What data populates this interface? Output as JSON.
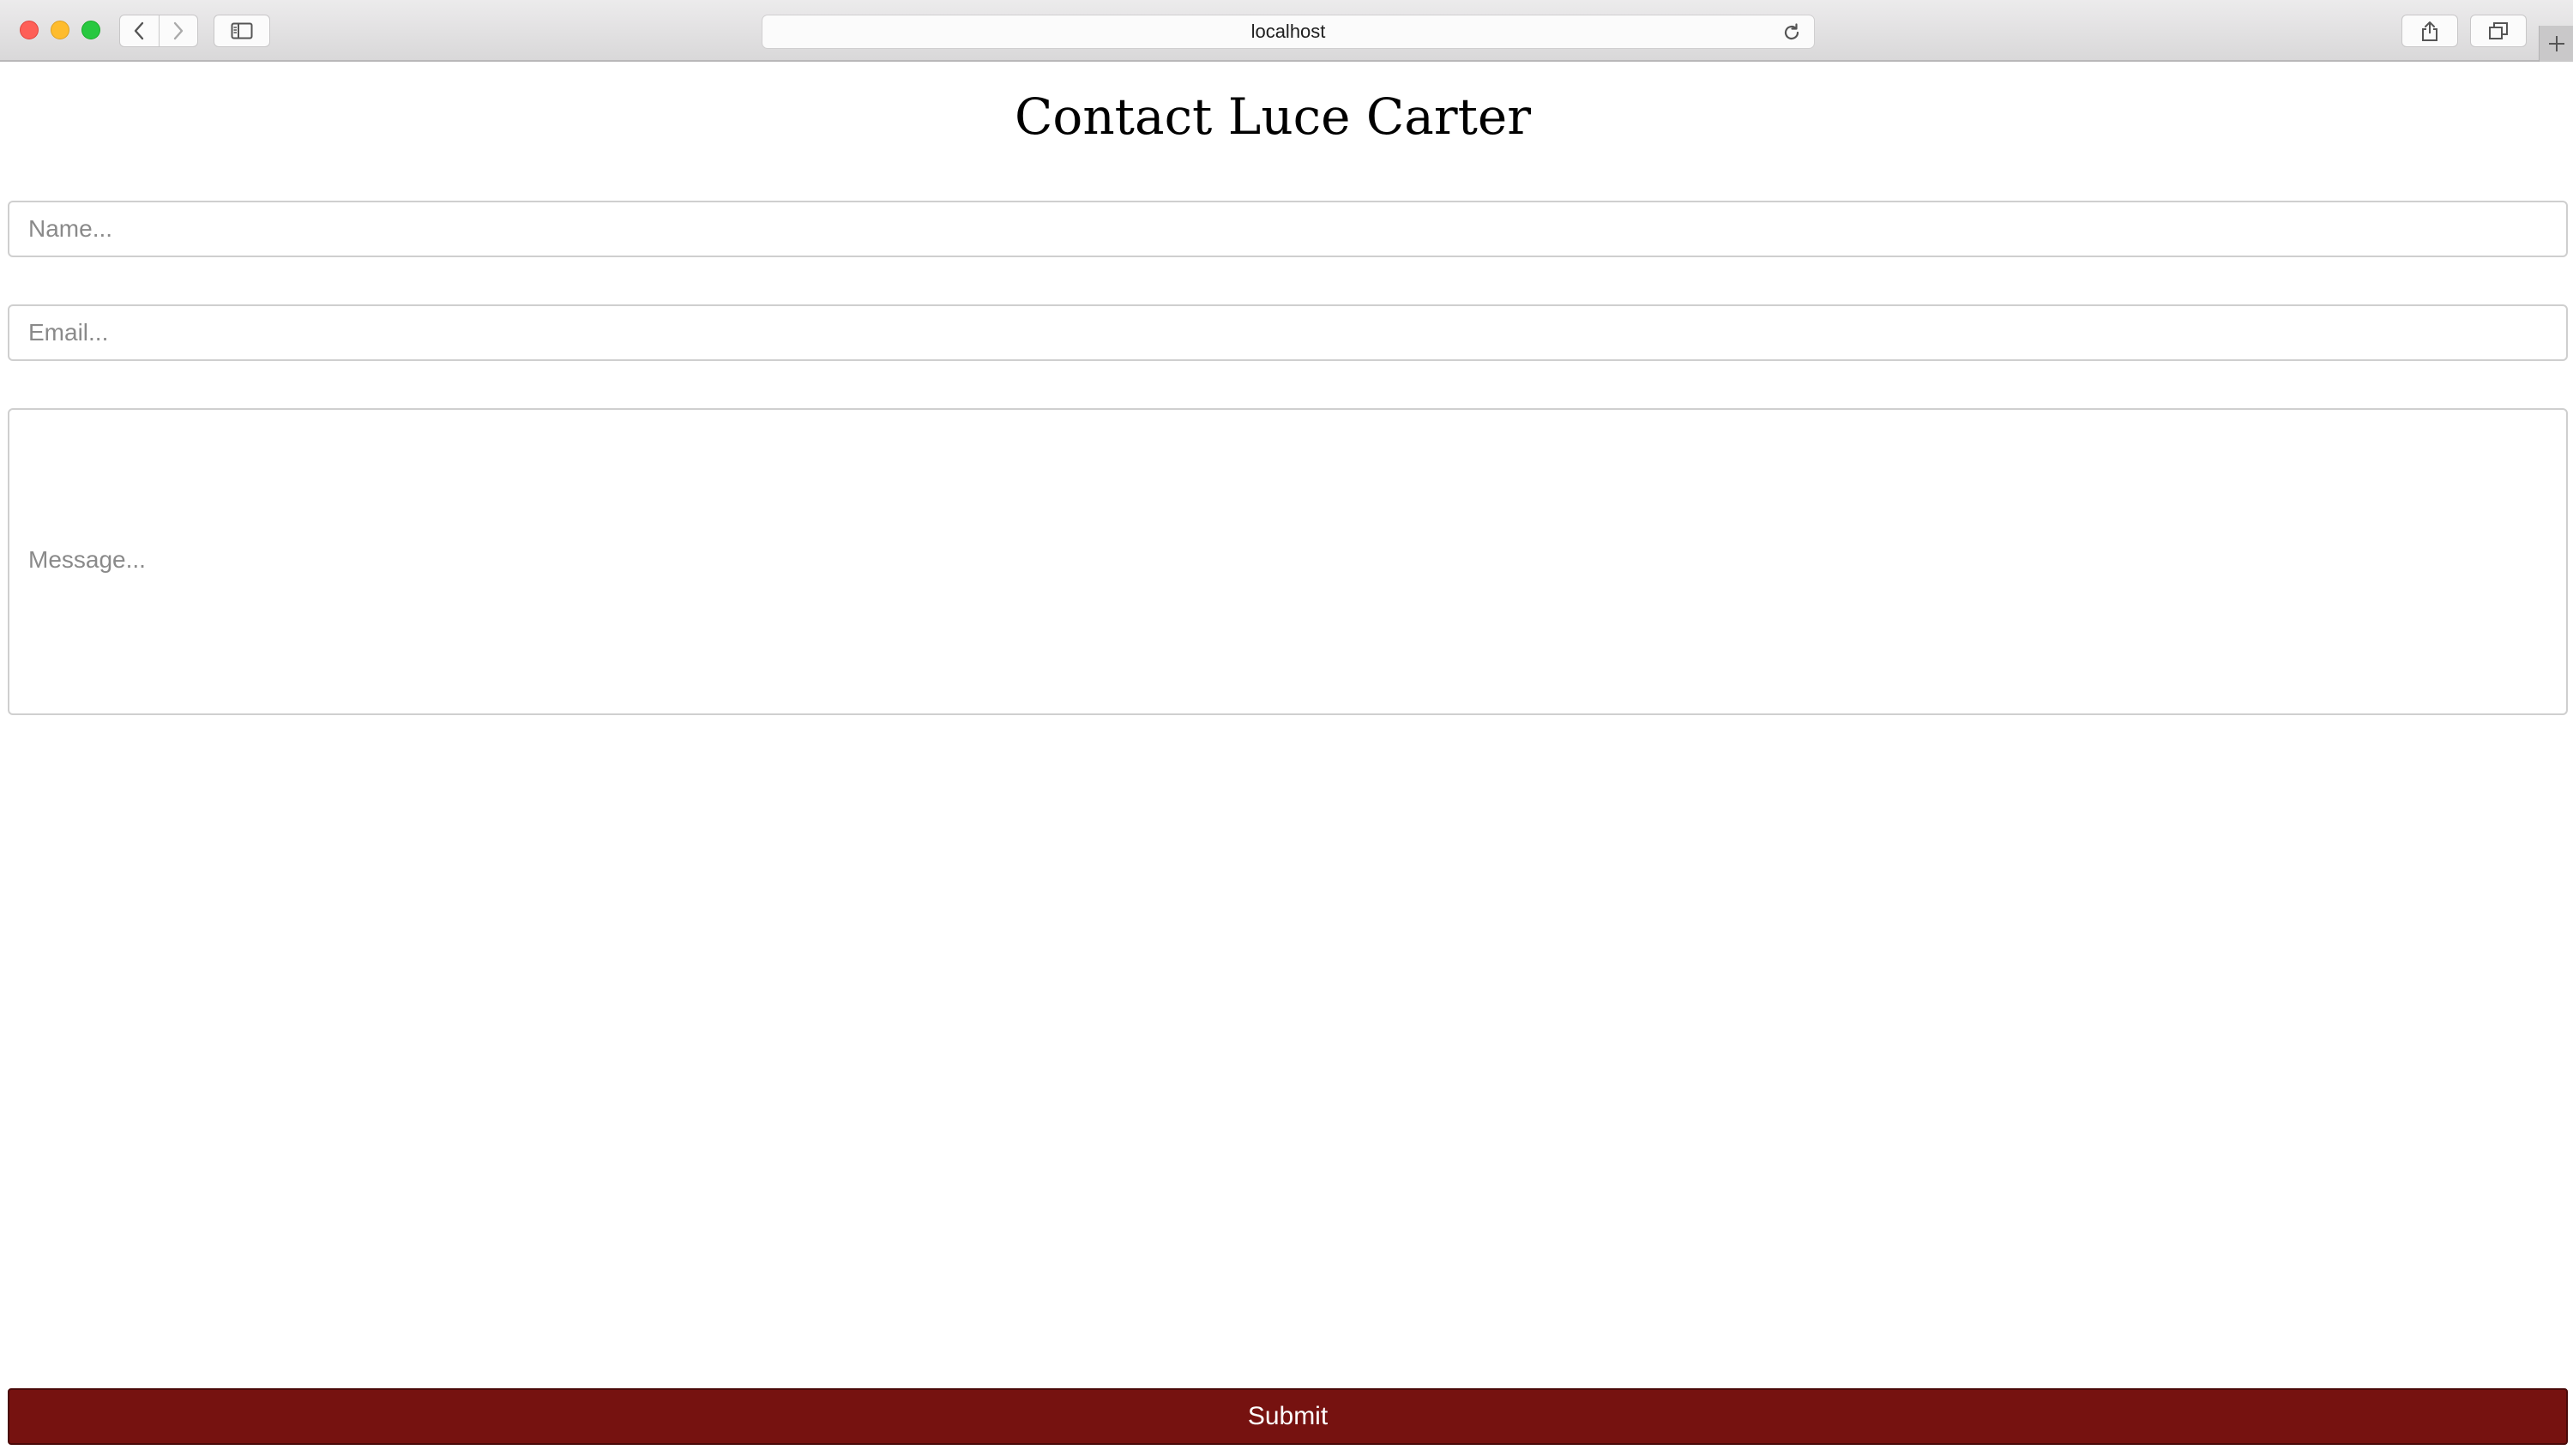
{
  "browser": {
    "url": "localhost"
  },
  "page": {
    "title": "Contact Luce Carter",
    "form": {
      "name_placeholder": "Name...",
      "email_placeholder": "Email...",
      "message_placeholder": "Message...",
      "submit_label": "Submit"
    }
  },
  "colors": {
    "submit_background": "#761210",
    "close": "#fe5f57",
    "minimize": "#febc2e",
    "maximize": "#28c840"
  }
}
